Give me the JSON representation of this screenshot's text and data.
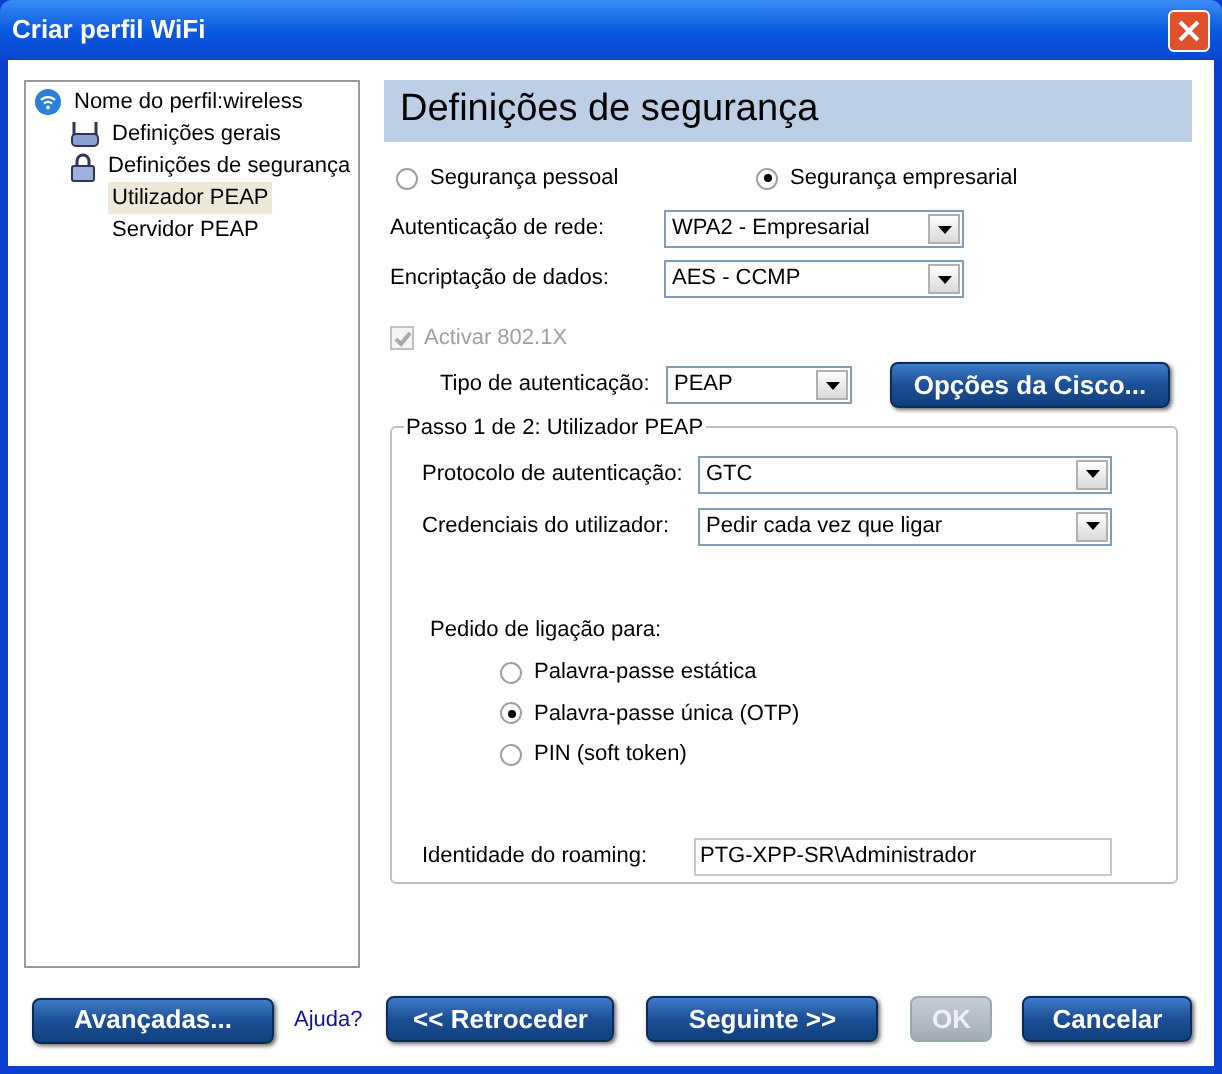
{
  "window": {
    "title": "Criar perfil WiFi"
  },
  "tree": [
    {
      "label": "Nome do perfil:wireless",
      "kind": "wifi",
      "selected": false,
      "children": [
        {
          "label": "Definições gerais",
          "kind": "router",
          "selected": false
        },
        {
          "label": "Definições de segurança",
          "kind": "lock",
          "selected": false,
          "children": [
            {
              "label": "Utilizador PEAP",
              "selected": true
            },
            {
              "label": "Servidor PEAP",
              "selected": false
            }
          ]
        }
      ]
    }
  ],
  "header": {
    "title": "Definições de segurança"
  },
  "security_mode": [
    {
      "label": "Segurança pessoal",
      "selected": false
    },
    {
      "label": "Segurança empresarial",
      "selected": true
    }
  ],
  "network_auth": {
    "label": "Autenticação de rede:",
    "value": "WPA2 - Empresarial"
  },
  "data_encryption": {
    "label": "Encriptação de dados:",
    "value": "AES - CCMP"
  },
  "enable_8021x": {
    "label": "Activar 802.1X",
    "checked": true,
    "disabled": true
  },
  "auth_type": {
    "label": "Tipo de autenticação:",
    "value": "PEAP"
  },
  "cisco_button": {
    "label": "Opções da Cisco...",
    "disabled": false
  },
  "step_group": {
    "title": "Passo 1 de 2: Utilizador PEAP",
    "protocol": {
      "label": "Protocolo de autenticação:",
      "value": "GTC"
    },
    "credentials": {
      "label": "Credenciais do utilizador:",
      "value": "Pedir cada vez que ligar"
    },
    "prompt_label": "Pedido de ligação para:",
    "prompt_options": [
      {
        "label": "Palavra-passe estática",
        "selected": false
      },
      {
        "label": "Palavra-passe única (OTP)",
        "selected": true
      },
      {
        "label": "PIN (soft token)",
        "selected": false
      }
    ],
    "roaming": {
      "label": "Identidade do roaming:",
      "value": "PTG-XPP-SR\\Administrador"
    }
  },
  "footer": {
    "advanced": {
      "label": "Avançadas...",
      "disabled": false
    },
    "help": "Ajuda?",
    "back": {
      "label": "<< Retroceder",
      "disabled": false
    },
    "next": {
      "label": "Seguinte >>",
      "disabled": false
    },
    "ok": {
      "label": "OK",
      "disabled": true
    },
    "cancel": {
      "label": "Cancelar",
      "disabled": false
    }
  }
}
